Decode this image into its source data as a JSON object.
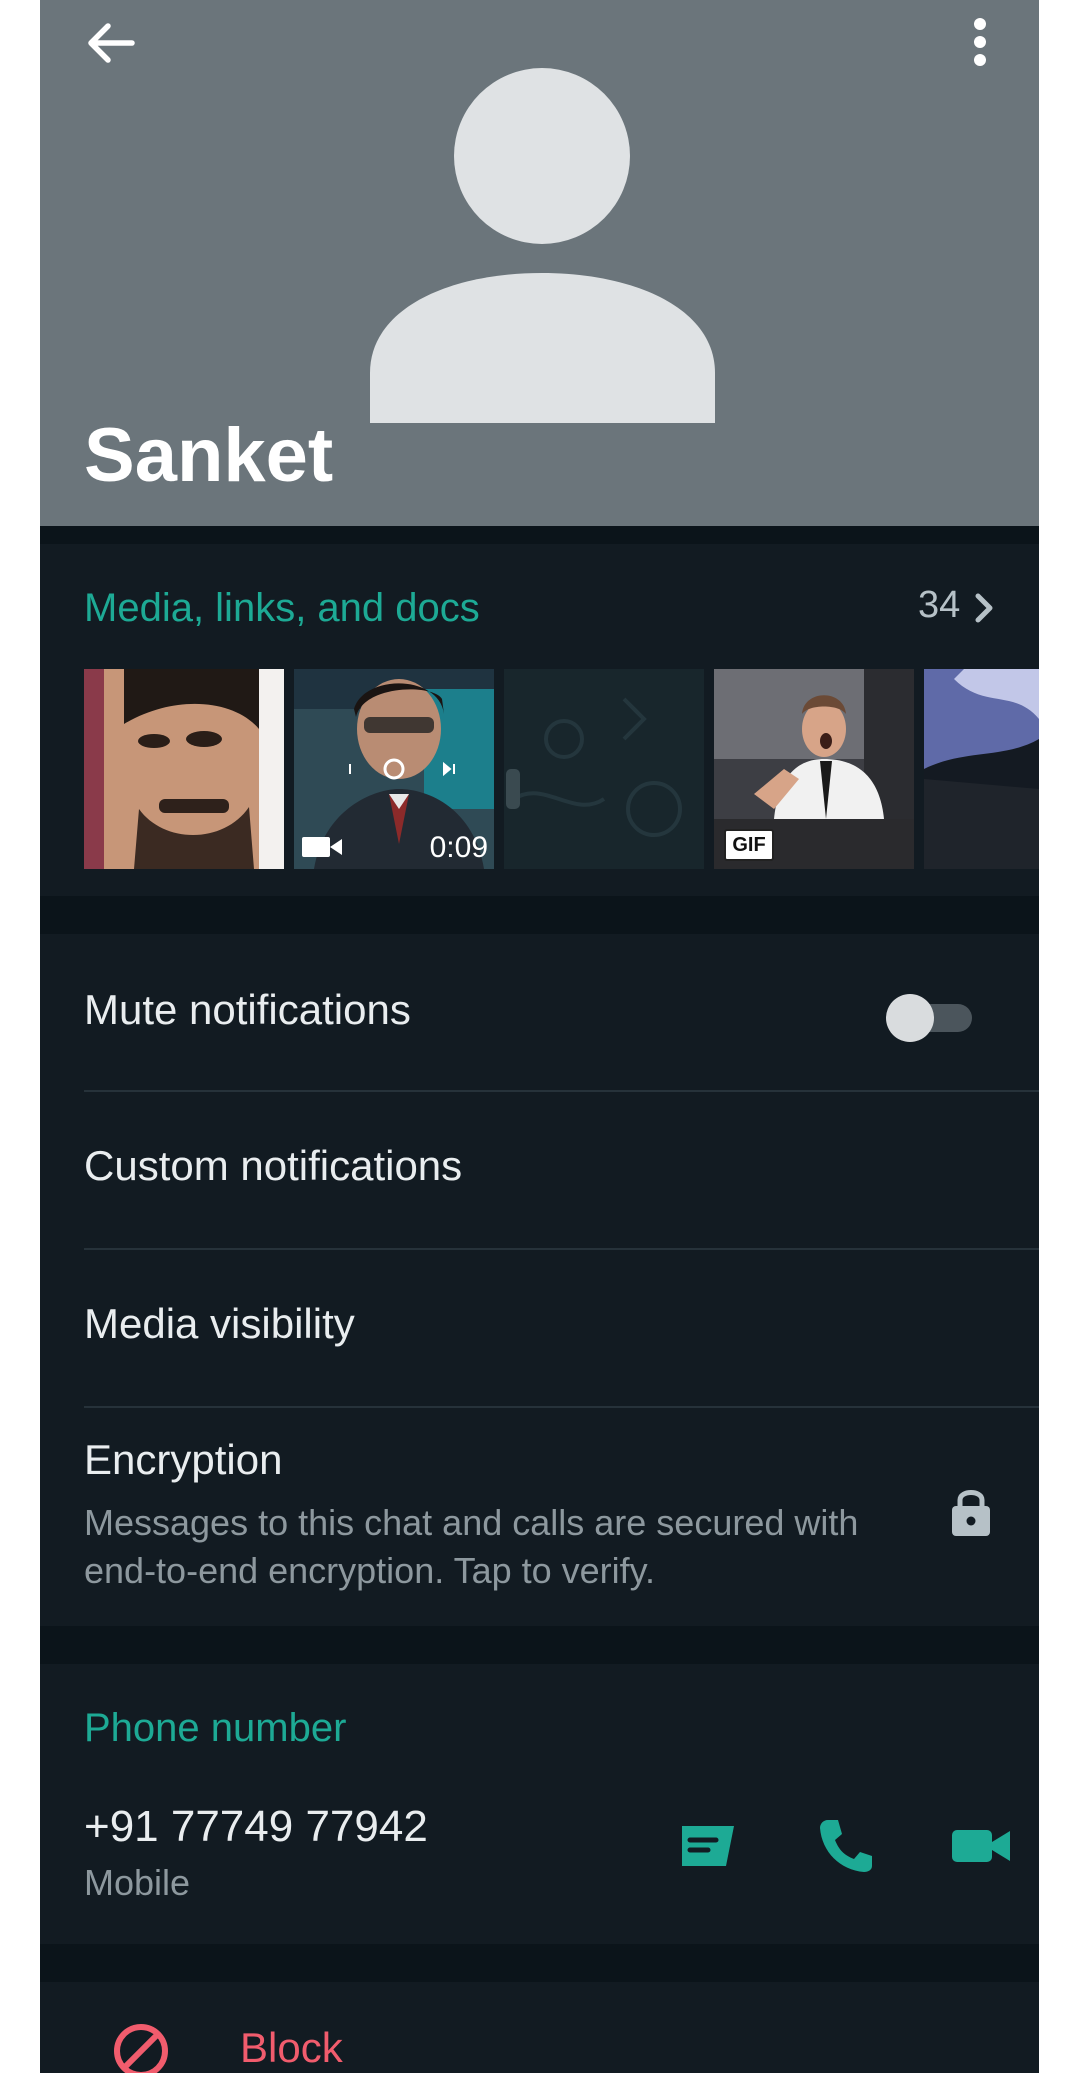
{
  "header": {
    "back_icon": "arrow-left-icon",
    "menu_icon": "more-vertical-icon",
    "contact_name": "Sanket",
    "background_color": "#6b757b"
  },
  "media": {
    "title": "Media, links, and docs",
    "count": "34",
    "video_duration": "0:09",
    "gif_label": "GIF"
  },
  "settings": {
    "mute_label": "Mute notifications",
    "mute_enabled": false,
    "custom_label": "Custom notifications",
    "visibility_label": "Media visibility",
    "encryption_title": "Encryption",
    "encryption_desc": "Messages to this chat and calls are secured with end-to-end encryption. Tap to verify."
  },
  "phone": {
    "title": "Phone number",
    "number": "+91 77749 77942",
    "type": "Mobile",
    "actions": [
      "message-icon",
      "phone-icon",
      "video-call-icon"
    ]
  },
  "block": {
    "label": "Block"
  },
  "colors": {
    "accent": "#1daa95",
    "danger": "#f15c6d",
    "background": "#0b141a",
    "section": "#121b22"
  }
}
